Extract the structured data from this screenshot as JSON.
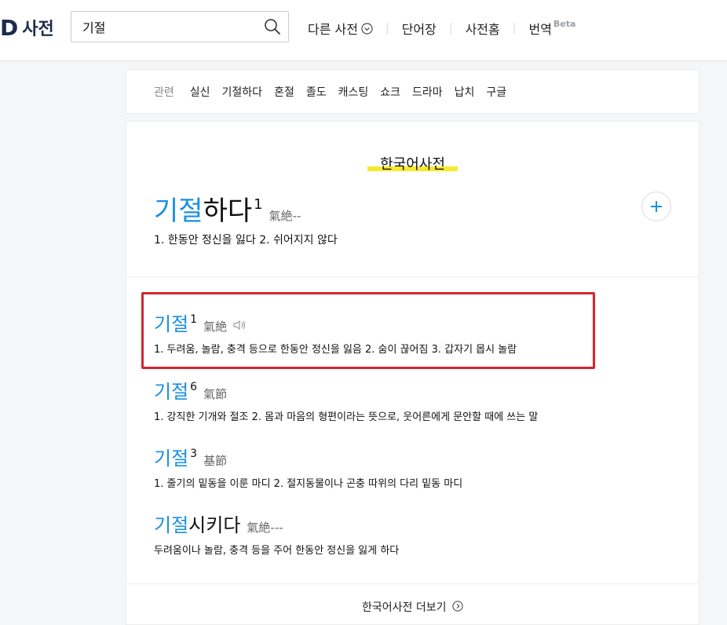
{
  "header": {
    "logo_mark": "D",
    "logo_text": "사전",
    "search_value": "기절",
    "nav": {
      "other_dict": "다른 사전",
      "wordbook": "단어장",
      "dict_home": "사전홈",
      "translate": "번역",
      "beta": "Beta"
    }
  },
  "related": {
    "label": "관련",
    "items": [
      "실신",
      "기절하다",
      "혼절",
      "졸도",
      "캐스팅",
      "쇼크",
      "드라마",
      "납치",
      "구글"
    ]
  },
  "section": {
    "title": "한국어사전",
    "main": {
      "word_hl": "기절",
      "word_rest": "하다",
      "sup": "1",
      "hanja": "氣絶--",
      "def": "1. 한동안 정신을 잃다   2. 쉬어지지 않다"
    },
    "entries": [
      {
        "word_hl": "기절",
        "word_rest": "",
        "sup": "1",
        "hanja": "氣絶",
        "def": "1. 두려움, 놀람, 충격 등으로 한동안 정신을 잃음   2. 숨이 끊어짐   3. 갑자기 몹시 놀람"
      },
      {
        "word_hl": "기절",
        "word_rest": "",
        "sup": "6",
        "hanja": "氣節",
        "def": "1. 강직한 기개와 절조   2. 몸과 마음의 형편이라는 뜻으로, 웃어른에게 문안할 때에 쓰는 말"
      },
      {
        "word_hl": "기절",
        "word_rest": "",
        "sup": "3",
        "hanja": "基節",
        "def": "1. 줄기의 밑동을 이룬 마디   2. 절지동물이나 곤충 따위의 다리 밑동 마디"
      },
      {
        "word_hl": "기절",
        "word_rest": "시키다",
        "sup": "",
        "hanja": "氣絶---",
        "def": "두려움이나 놀람, 충격 등을 주어 한동안 정신을 잃게 하다"
      }
    ],
    "more": "한국어사전 더보기"
  },
  "colors": {
    "accent_blue": "#1a8fe3",
    "highlight_yellow": "#f7ea2a",
    "annotation_red": "#d7242d"
  }
}
